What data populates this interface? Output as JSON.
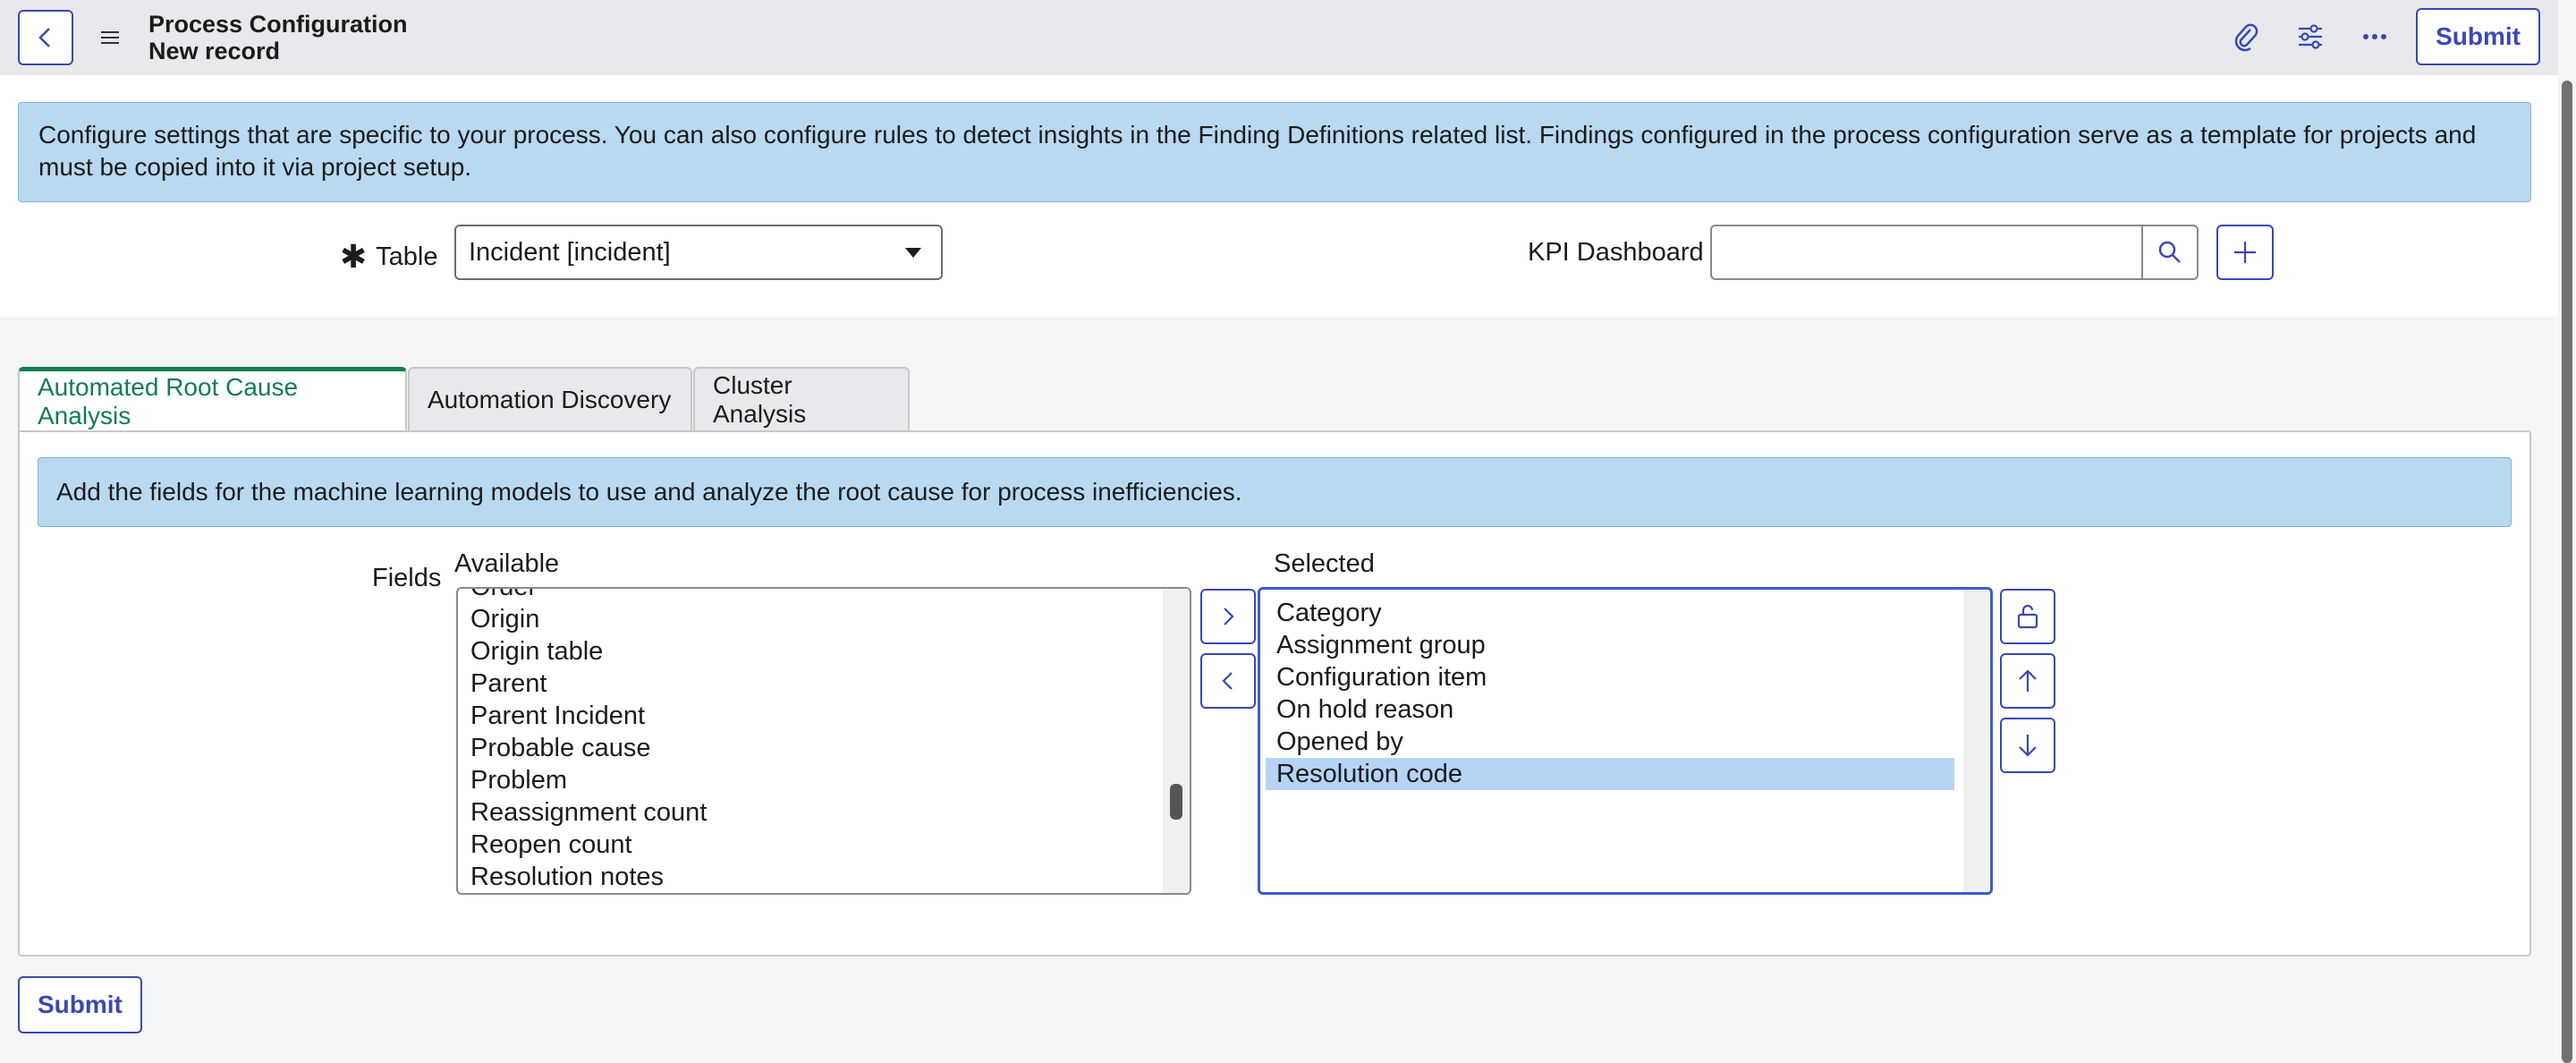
{
  "header": {
    "title": "Process Configuration",
    "subtitle": "New record",
    "submit_label": "Submit",
    "icons": [
      "back-icon",
      "menu-icon",
      "attachment-icon",
      "settings-sliders-icon",
      "more-icon"
    ]
  },
  "info_banner": "Configure settings that are specific to your process. You can also configure rules to detect insights in the Finding Definitions related list. Findings configured in the process configuration serve as a template for projects and must be copied into it via project setup.",
  "form": {
    "table_label": "Table",
    "table_value": "Incident [incident]",
    "kpi_label": "KPI Dashboard",
    "kpi_value": ""
  },
  "tabs": [
    {
      "label": "Automated Root Cause Analysis",
      "active": true
    },
    {
      "label": "Automation Discovery",
      "active": false
    },
    {
      "label": "Cluster Analysis",
      "active": false
    }
  ],
  "tab_panel": {
    "banner": "Add the fields for the machine learning models to use and analyze the root cause for process inefficiencies.",
    "fields_label": "Fields",
    "available_label": "Available",
    "selected_label": "Selected",
    "available": [
      "Order",
      "Origin",
      "Origin table",
      "Parent",
      "Parent Incident",
      "Probable cause",
      "Problem",
      "Reassignment count",
      "Reopen count",
      "Resolution notes"
    ],
    "selected": [
      "Category",
      "Assignment group",
      "Configuration item",
      "On hold reason",
      "Opened by",
      "Resolution code"
    ],
    "selected_highlight": "Resolution code"
  },
  "footer": {
    "submit_label": "Submit"
  },
  "colors": {
    "accent": "#3b47b5",
    "tab_active": "#127d52",
    "banner_bg": "#b9d9f1",
    "selection": "#b5d4f5"
  }
}
